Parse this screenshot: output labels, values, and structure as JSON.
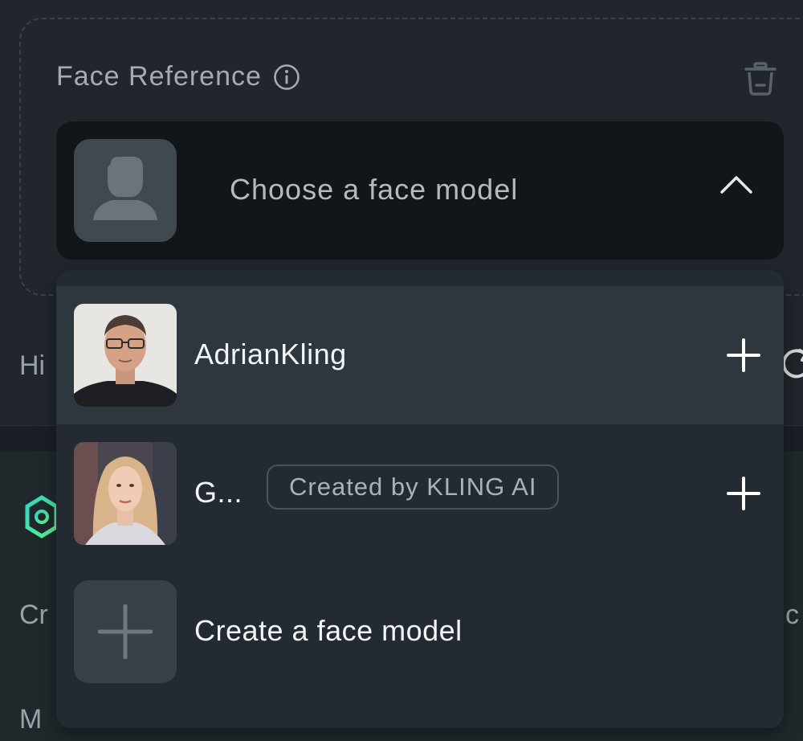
{
  "face_reference": {
    "title": "Face Reference",
    "info_icon": "info-circle-icon",
    "delete_icon": "trash-icon"
  },
  "selector": {
    "placeholder_label": "Choose a face model",
    "avatar_icon": "person-silhouette-icon",
    "toggle_icon": "chevron-up-icon"
  },
  "background": {
    "truncated_left_1": "Hi",
    "truncated_left_2": "Cr",
    "truncated_right": "c",
    "truncated_bottom": "M"
  },
  "dropdown": {
    "options": [
      {
        "name": "AdrianKling",
        "badge": "",
        "action_icon": "plus-icon"
      },
      {
        "name": "G...",
        "badge": "Created by KLING AI",
        "action_icon": "plus-icon"
      }
    ],
    "create": {
      "label": "Create a face model",
      "icon": "plus-icon"
    }
  },
  "colors": {
    "page_bg": "#1b1f25",
    "dropdown_bg": "#232a31",
    "highlight_bg": "#2e363e",
    "selector_bg": "#121619",
    "accent_logo": "#2fd7c3"
  }
}
